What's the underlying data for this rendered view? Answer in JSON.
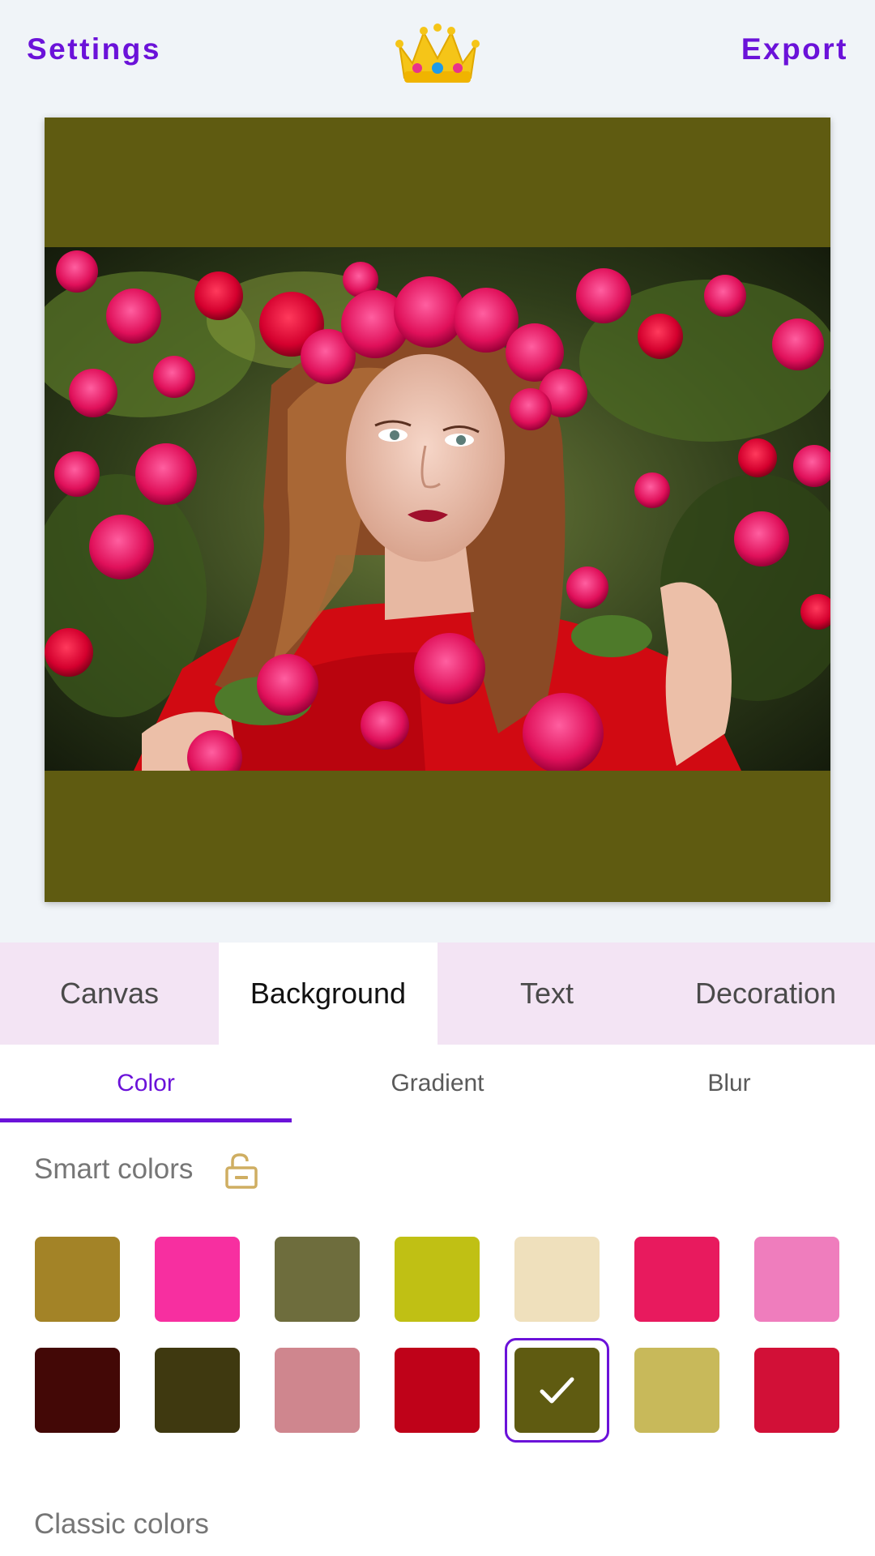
{
  "header": {
    "settings_label": "Settings",
    "export_label": "Export",
    "crown_icon": "crown-icon"
  },
  "canvas": {
    "background_color": "#5f5b11"
  },
  "main_tabs": [
    {
      "label": "Canvas",
      "active": false
    },
    {
      "label": "Background",
      "active": true
    },
    {
      "label": "Text",
      "active": false
    },
    {
      "label": "Decoration",
      "active": false
    }
  ],
  "sub_tabs": [
    {
      "label": "Color",
      "active": true
    },
    {
      "label": "Gradient",
      "active": false
    },
    {
      "label": "Blur",
      "active": false
    }
  ],
  "smart_colors": {
    "title": "Smart colors",
    "lock_icon": "unlock-icon",
    "swatches": [
      "#a38327",
      "#f72fa0",
      "#6e6d3d",
      "#c0c014",
      "#efe0bc",
      "#e81a5e",
      "#ef7dbd",
      "#430806",
      "#3f3910",
      "#cf868e",
      "#bf0219",
      "#5f5b11",
      "#c8b95a",
      "#d21037"
    ],
    "selected_index": 11
  },
  "classic_colors": {
    "title": "Classic colors"
  },
  "colors": {
    "accent": "#6b12d9",
    "tab_bar_bg": "#f3e4f4",
    "page_bg": "#f0f4f8"
  }
}
